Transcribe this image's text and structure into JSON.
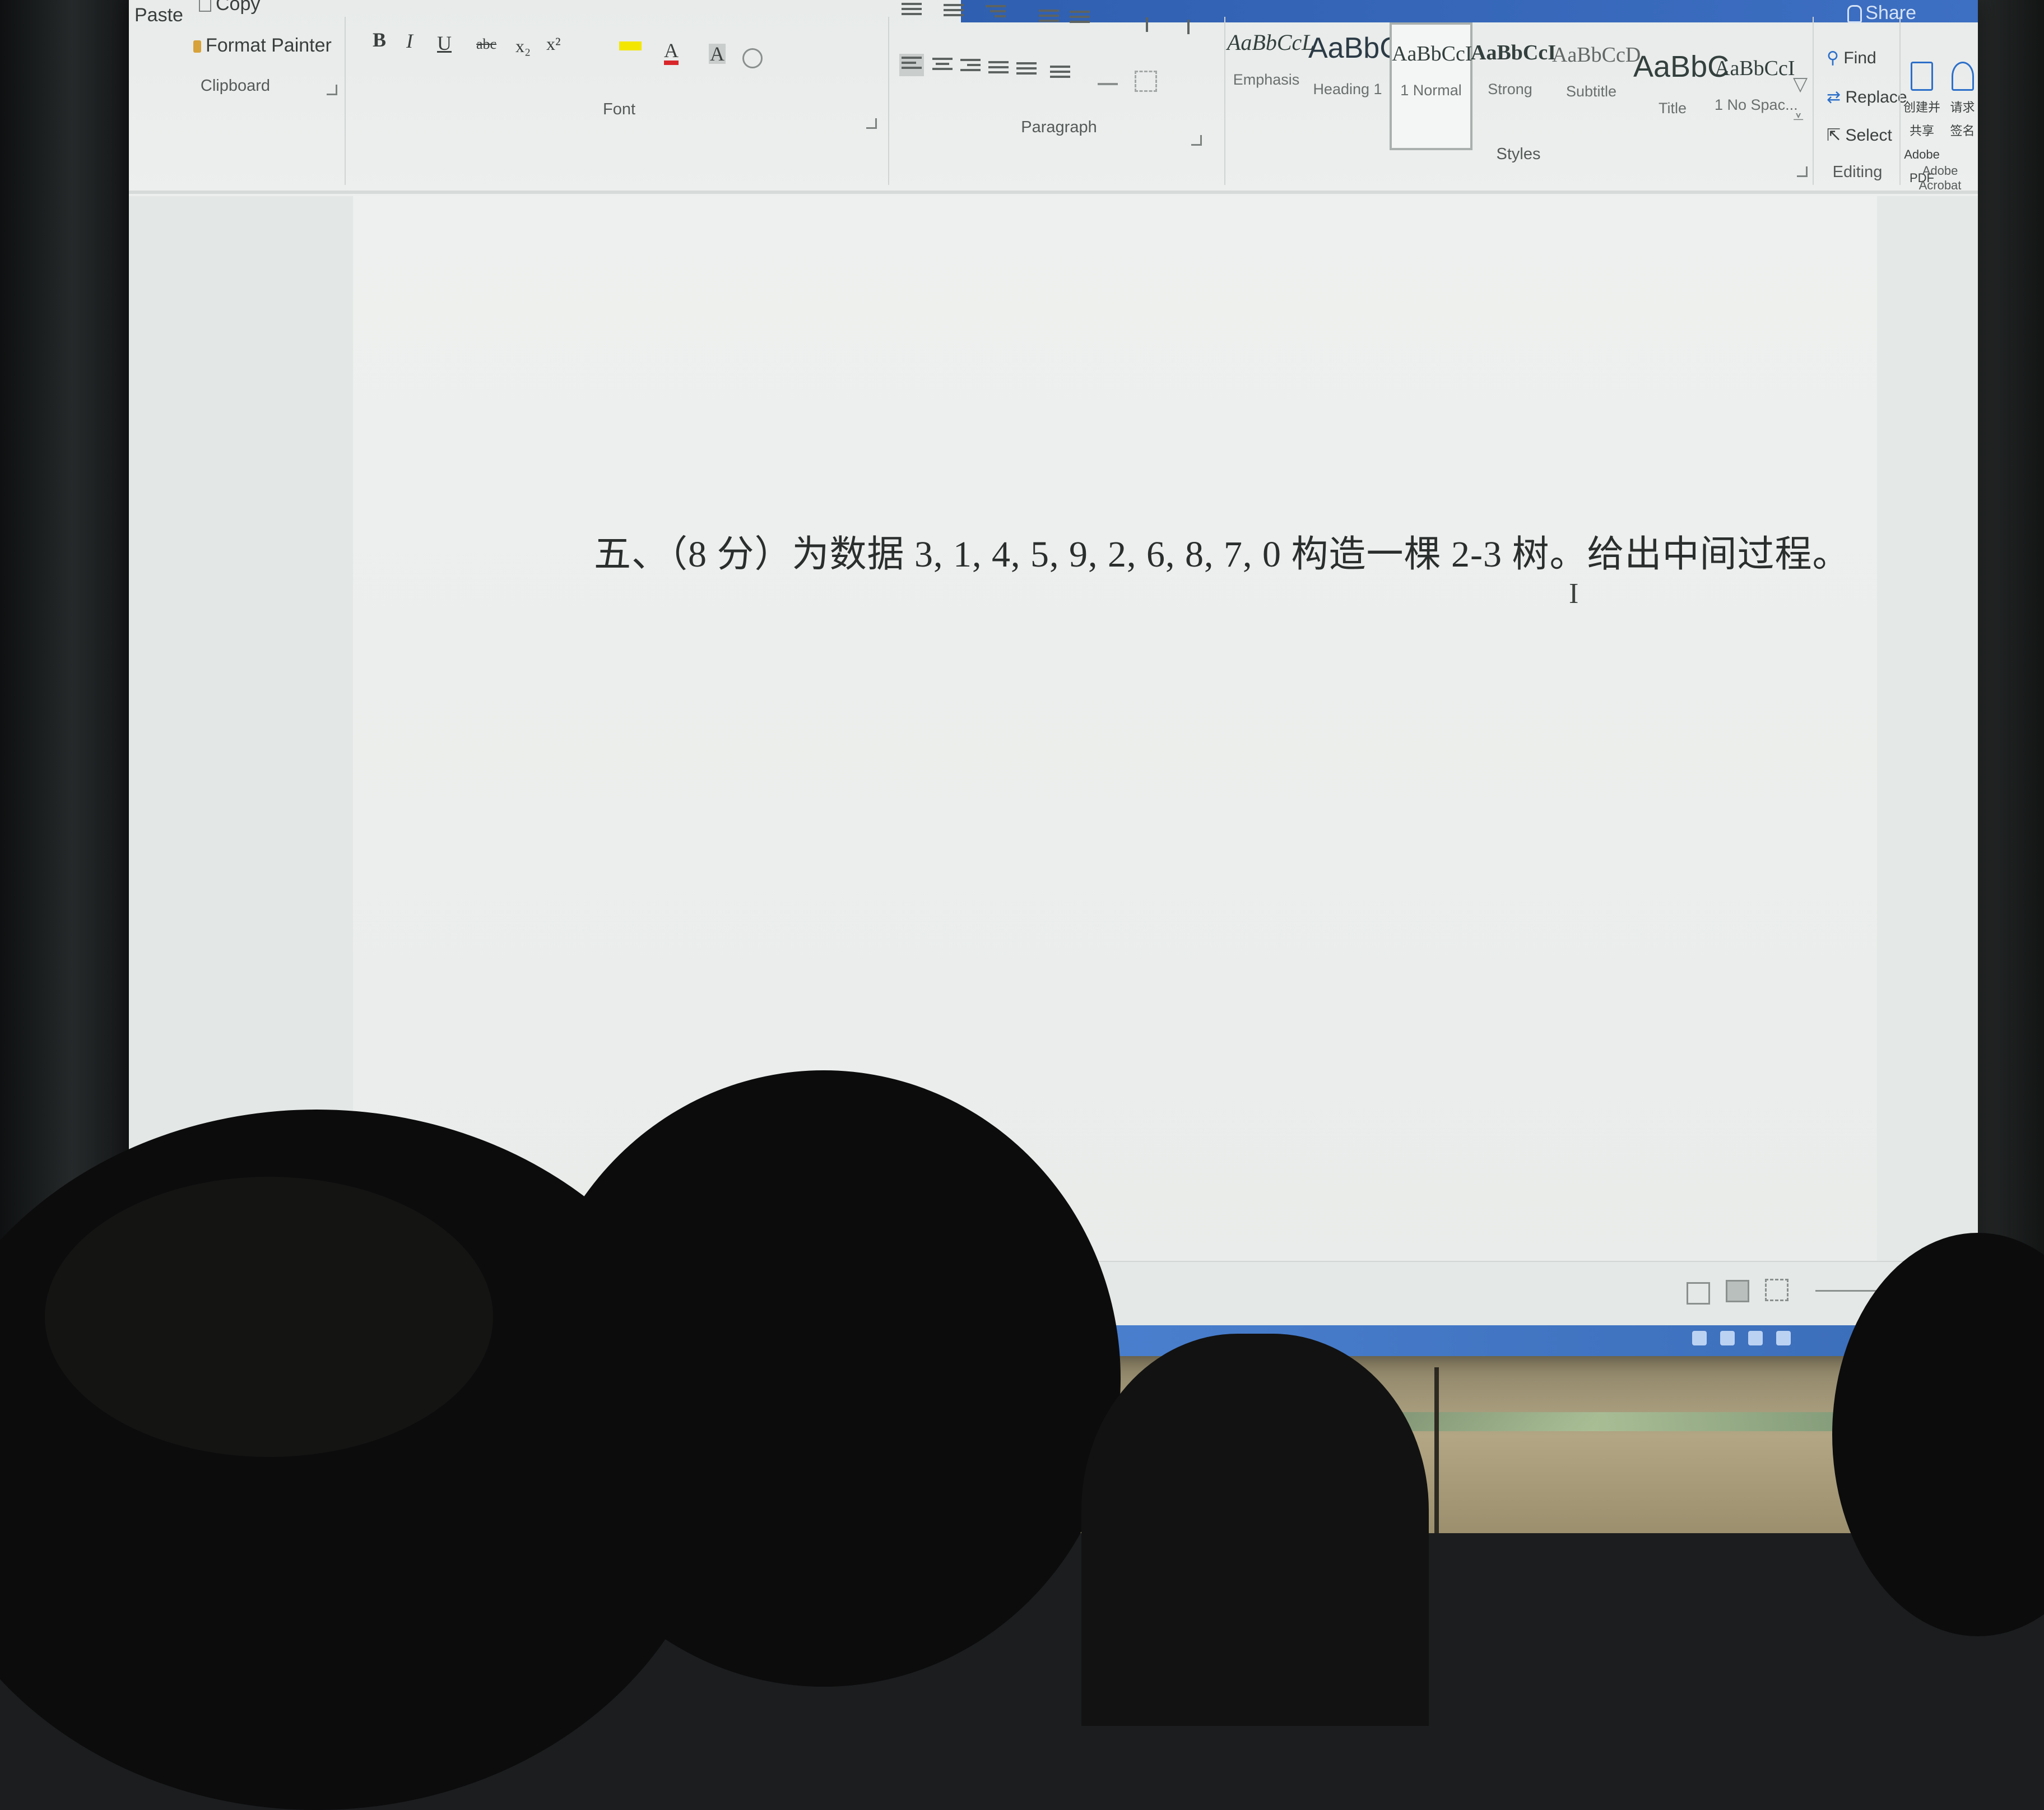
{
  "titlebar": {
    "share_label": "Share",
    "color": "#3465b9"
  },
  "clipboard": {
    "paste_label": "Paste",
    "copy_label": "Copy",
    "format_painter_label": "Format Painter",
    "group_label": "Clipboard"
  },
  "font": {
    "group_label": "Font",
    "bold": "B",
    "italic": "I",
    "underline": "U",
    "strikethrough": "abc",
    "subscript": "x₂",
    "superscript": "x²",
    "font_color": "A",
    "char_shading": "A",
    "highlight_color": "#f3e600",
    "font_color_bar": "#d8262b"
  },
  "paragraph": {
    "group_label": "Paragraph"
  },
  "styles": {
    "group_label": "Styles",
    "items": [
      {
        "sample": "AaBbCcL",
        "name": "Emphasis"
      },
      {
        "sample": "AaBbC",
        "name": "Heading 1"
      },
      {
        "sample": "AaBbCcI",
        "name": "1 Normal"
      },
      {
        "sample": "AaBbCcI",
        "name": "Strong"
      },
      {
        "sample": "AaBbCcD",
        "name": "Subtitle"
      },
      {
        "sample": "AaBbC",
        "name": "Title"
      },
      {
        "sample": "AaBbCcI",
        "name": "1 No Spac..."
      }
    ],
    "selected_index": 2
  },
  "editing": {
    "group_label": "Editing",
    "find_label": "Find",
    "replace_label": "Replace",
    "select_label": "Select"
  },
  "acrobat": {
    "group_label": "Adobe Acrobat",
    "create_share_line1": "创建并共享",
    "create_share_line2": "Adobe PDF",
    "request_sign_line1": "请求",
    "request_sign_line2": "签名"
  },
  "document": {
    "question": "五、（8 分）为数据 3, 1, 4, 5, 9, 2, 6, 8, 7, 0 构造一棵 2-3 树。给出中间过程。",
    "cursor": "I"
  }
}
